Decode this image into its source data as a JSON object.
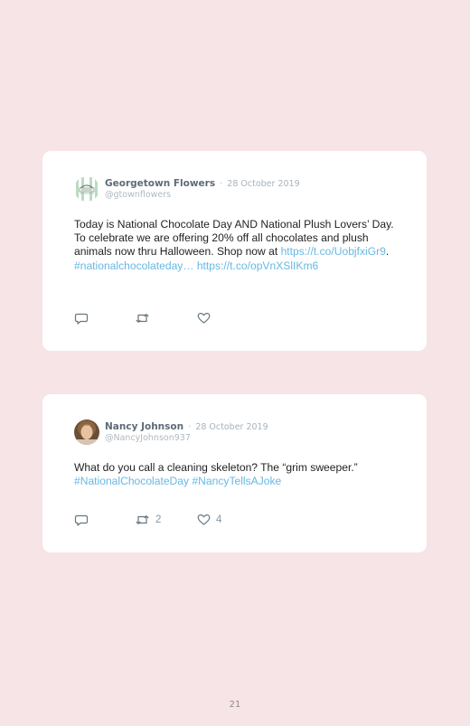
{
  "tweets": [
    {
      "author": "Georgetown Flowers",
      "separator": "·",
      "date": "28 October 2019",
      "handle": "@gtownflowers",
      "text_segments": [
        {
          "text": "Today is National Chocolate Day AND National Plush Lovers’ Day. To celebrate we are offering 20% off all chocolates and plush animals now thru Halloween. Shop now at ",
          "link": false
        },
        {
          "text": "https://t.co/UobjfxiGr9",
          "link": true
        },
        {
          "text": ". ",
          "link": false
        },
        {
          "text": "#nationalchocolateday…",
          "link": true
        },
        {
          "text": " ",
          "link": false
        },
        {
          "text": "https://t.co/opVnXSlIKm6",
          "link": true
        }
      ],
      "retweets": "",
      "likes": "",
      "avatar_icon": "flower-shop-logo-icon"
    },
    {
      "author": "Nancy Johnson",
      "separator": "·",
      "date": "28 October 2019",
      "handle": "@NancyJohnson937",
      "text_segments": [
        {
          "text": "What do you call a cleaning skeleton? The “grim sweeper.” ",
          "link": false
        },
        {
          "text": "#NationalChocolateDay",
          "link": true
        },
        {
          "text": " ",
          "link": false
        },
        {
          "text": "#NancyTellsAJoke",
          "link": true
        }
      ],
      "retweets": "2",
      "likes": "4",
      "avatar_icon": "profile-photo"
    }
  ],
  "icons": {
    "reply": "reply-icon",
    "retweet": "retweet-icon",
    "like": "heart-icon"
  },
  "colors": {
    "page_background": "#f7e4e6",
    "card_background": "#ffffff",
    "link": "#67b8e3",
    "author": "#5d6b78",
    "muted": "#a7b2bb"
  },
  "page_number": "21"
}
